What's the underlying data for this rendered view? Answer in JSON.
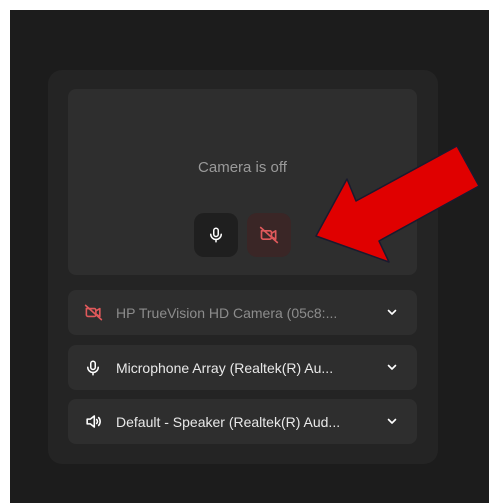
{
  "preview": {
    "status_text": "Camera is off"
  },
  "controls": {
    "mic_icon": "microphone-icon",
    "camera_icon": "camera-off-icon"
  },
  "devices": [
    {
      "icon": "camera-off-icon",
      "label": "HP TrueVision HD Camera (05c8:..."
    },
    {
      "icon": "microphone-icon",
      "label": "Microphone Array (Realtek(R) Au..."
    },
    {
      "icon": "speaker-icon",
      "label": "Default - Speaker (Realtek(R) Aud..."
    }
  ],
  "annotation": {
    "arrow_color": "#e00000"
  },
  "colors": {
    "background": "#1c1c1c",
    "panel": "#242424",
    "surface": "#2e2e2e",
    "camera_off_red": "#e0595b"
  }
}
